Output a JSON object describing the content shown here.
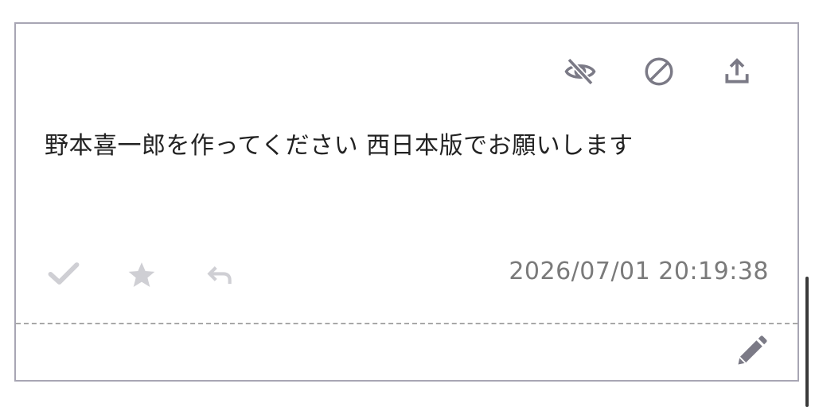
{
  "message": {
    "text": "野本喜一郎を作ってください 西日本版でお願いします",
    "timestamp": "2026/07/01 20:19:38"
  },
  "top_actions": [
    {
      "icon": "eye-off-icon",
      "name": "hide-button"
    },
    {
      "icon": "block-icon",
      "name": "block-button"
    },
    {
      "icon": "share-icon",
      "name": "share-button"
    }
  ],
  "bottom_actions": [
    {
      "icon": "check-icon",
      "name": "approve-button"
    },
    {
      "icon": "star-icon",
      "name": "favorite-button"
    },
    {
      "icon": "reply-icon",
      "name": "reply-button"
    }
  ],
  "edit_action": {
    "icon": "pencil-icon",
    "name": "edit-button"
  },
  "colors": {
    "icon_dark": "#7b7a86",
    "icon_light": "#cfcfd4",
    "border": "#a8a6b4",
    "text": "#222222",
    "timestamp": "#7a7a7a"
  }
}
